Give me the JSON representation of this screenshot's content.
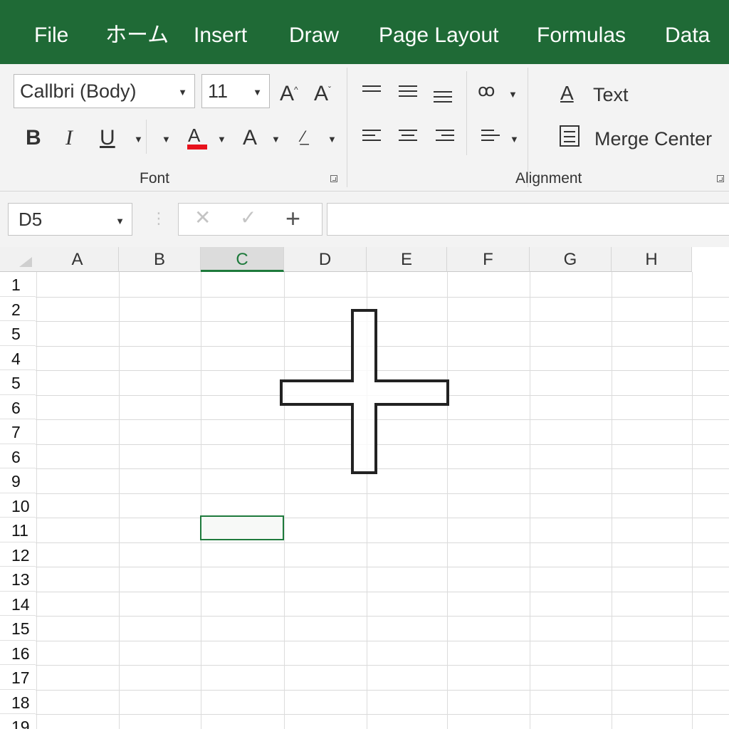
{
  "menu": [
    "File",
    "ホーム",
    "Insert",
    "Draw",
    "Page Layout",
    "Formulas",
    "Data"
  ],
  "ribbon": {
    "font_name": "Callbri (Body)",
    "font_size": "11",
    "font_group_label": "Font",
    "alignment_group_label": "Alignment",
    "bold": "B",
    "italic": "I",
    "underline": "U",
    "font_color_glyph": "A",
    "font_color": "#e8121c",
    "font_size_glyph": "A",
    "grow_font_glyph": "A",
    "shrink_font_glyph": "A",
    "wrap_text_glyph": "A",
    "wrap_text_label": "Text",
    "merge_center_label": "Merge Center"
  },
  "formula_bar": {
    "name_box": "D5",
    "cancel_glyph": "✕",
    "enter_glyph": "✓",
    "insert_function_glyph": "+",
    "formula_value": ""
  },
  "sheet": {
    "columns": [
      "A",
      "B",
      "C",
      "D",
      "E",
      "F",
      "G",
      "H"
    ],
    "rows": [
      "1",
      "2",
      "5",
      "4",
      "5",
      "6",
      "7",
      "6",
      "9",
      "10",
      "11",
      "12",
      "13",
      "14",
      "15",
      "16",
      "17",
      "18",
      "19"
    ],
    "selected_column": "C",
    "selection_color": "#1e7a3c"
  }
}
